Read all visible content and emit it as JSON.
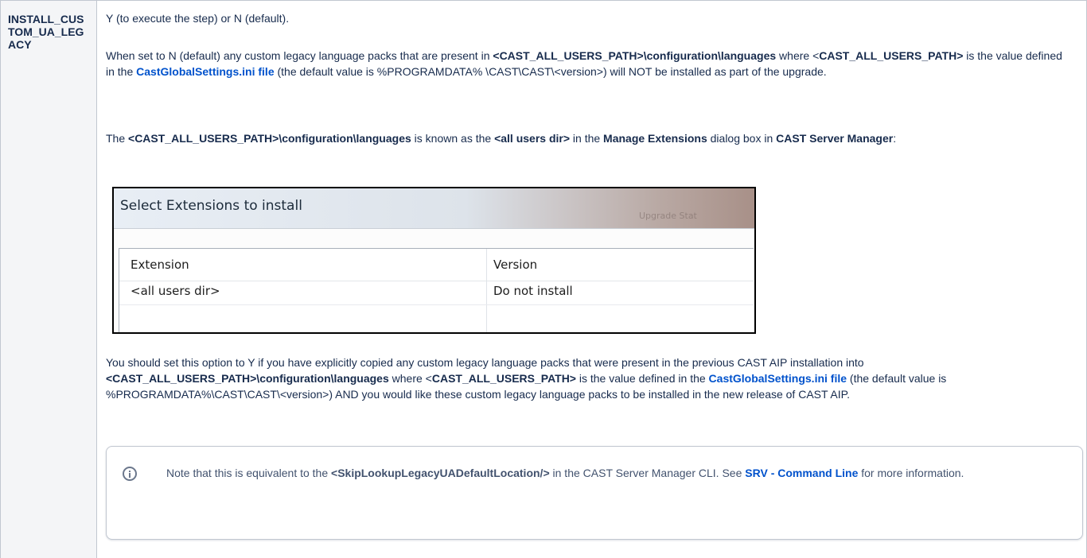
{
  "row": {
    "key": "INSTALL_CUSTOM_UA_LEGACY"
  },
  "p1": "Y (to execute the step) or N (default).",
  "p2": {
    "a": "When set to N (default) any custom legacy language packs that are present in ",
    "b1": "<CAST_ALL_USERS_PATH>\\configuration\\languages",
    "c": " where <",
    "b2": "CAST_ALL_USERS_PATH>",
    "d": " is the value defined in the ",
    "link": "CastGlobalSettings.ini file",
    "e": " (the default value is %PROGRAMDATA% \\CAST\\CAST\\<version>) will NOT be installed as part of the upgrade."
  },
  "p3": {
    "a": "The ",
    "b1": "<CAST_ALL_USERS_PATH>\\configuration\\languages",
    "c": " is known as the ",
    "b2": "<all users dir>",
    "d": " in the ",
    "b3": "Manage Extensions",
    "e": " dialog box in ",
    "b4": "CAST Server Manager",
    "f": ":"
  },
  "screenshot": {
    "title": "Select Extensions to install",
    "faded_tab": "Upgrade Stat",
    "col_extension": "Extension",
    "col_version": "Version",
    "row_extension": "<all users dir>",
    "row_version": "Do not install"
  },
  "p4": {
    "a": "You should set this option to Y if you have explicitly copied any custom legacy language packs that were present in the previous CAST AIP installation into ",
    "b1": "<CAST_ALL_USERS_PATH>\\configuration\\languages",
    "c": " where <",
    "b2": "CAST_ALL_USERS_PATH>",
    "d": " is the value defined in the ",
    "link": "CastGlobalSettings.ini file",
    "e": " (the default value is %PROGRAMDATA%\\CAST\\CAST\\<version>) AND you would like these custom legacy language packs to be installed in the new release of CAST AIP."
  },
  "note": {
    "icon": "info-icon",
    "a": "Note that this is equivalent to the ",
    "b1": "<SkipLookupLegacyUADefaultLocation/>",
    "c": " in the CAST Server Manager CLI. See ",
    "link": "SRV - Command Line",
    "d": " for more information."
  },
  "colors": {
    "link": "#0052cc",
    "text": "#172b4d",
    "key_bg": "#f4f5f7",
    "border": "#c1c7d0"
  }
}
